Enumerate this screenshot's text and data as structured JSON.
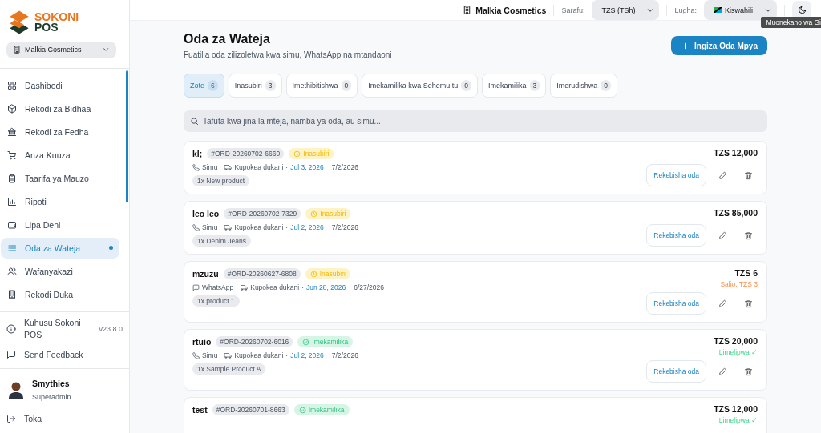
{
  "brand": {
    "line1": "SOKONI",
    "line2": "POS"
  },
  "store_selector": {
    "value": "Malkia Cosmetics"
  },
  "nav": [
    {
      "label": "Dashibodi",
      "selected": false
    },
    {
      "label": "Rekodi za Bidhaa",
      "selected": false
    },
    {
      "label": "Rekodi za Fedha",
      "selected": false
    },
    {
      "label": "Anza Kuuza",
      "selected": false
    },
    {
      "label": "Taarifa ya Mauzo",
      "selected": false
    },
    {
      "label": "Ripoti",
      "selected": false
    },
    {
      "label": "Lipa Deni",
      "selected": false
    },
    {
      "label": "Oda za Wateja",
      "selected": true
    },
    {
      "label": "Wafanyakazi",
      "selected": false
    },
    {
      "label": "Rekodi Duka",
      "selected": false
    }
  ],
  "about": {
    "label": "Kuhusu Sokoni POS",
    "version": "v23.8.0"
  },
  "feedback": {
    "label": "Send Feedback"
  },
  "user": {
    "name": "Smythies",
    "role": "Superadmin"
  },
  "logout": {
    "label": "Toka"
  },
  "topbar": {
    "store": "Malkia Cosmetics",
    "currency_label": "Sarafu:",
    "currency": "TZS (TSh)",
    "language_label": "Lugha:",
    "language": "Kiswahili",
    "tooltip": "Muonekano wa Gi"
  },
  "page": {
    "title": "Oda za Wateja",
    "subtitle": "Fuatilia oda zilizoletwa kwa simu, WhatsApp na mtandaoni",
    "new_button": "Ingiza Oda Mpya"
  },
  "filters": [
    {
      "label": "Zote",
      "count": "6",
      "selected": true
    },
    {
      "label": "Inasubiri",
      "count": "3",
      "selected": false
    },
    {
      "label": "Imethibitishwa",
      "count": "0",
      "selected": false
    },
    {
      "label": "Imekamilika kwa Sehemu tu",
      "count": "0",
      "selected": false
    },
    {
      "label": "Imekamilika",
      "count": "3",
      "selected": false
    },
    {
      "label": "Imerudishwa",
      "count": "0",
      "selected": false
    }
  ],
  "search": {
    "placeholder": "Tafuta kwa jina la mteja, namba ya oda, au simu..."
  },
  "orders": [
    {
      "customer": "kl;",
      "number": "#ORD-20260702-6660",
      "status": {
        "kind": "pending",
        "label": "Inasubiri"
      },
      "channel": {
        "kind": "phone",
        "label": "Simu"
      },
      "delivery": "Kupokea dukani",
      "separator": "·",
      "due": "Jul 3, 2026",
      "date": "7/2/2026",
      "items": [
        "1x New product"
      ],
      "total": "TZS 12,000",
      "action": "Rekebisha oda"
    },
    {
      "customer": "leo leo",
      "number": "#ORD-20260702-7329",
      "status": {
        "kind": "pending",
        "label": "Inasubiri"
      },
      "channel": {
        "kind": "phone",
        "label": "Simu"
      },
      "delivery": "Kupokea dukani",
      "separator": "·",
      "due": "Jul 2, 2026",
      "date": "7/2/2026",
      "items": [
        "1x Denim Jeans"
      ],
      "total": "TZS 85,000",
      "action": "Rekebisha oda"
    },
    {
      "customer": "mzuzu",
      "number": "#ORD-20260627-6808",
      "status": {
        "kind": "pending",
        "label": "Inasubiri"
      },
      "channel": {
        "kind": "whatsapp",
        "label": "WhatsApp"
      },
      "delivery": "Kupokea dukani",
      "separator": "·",
      "due": "Jun 28, 2026",
      "date": "6/27/2026",
      "items": [
        "1x product 1"
      ],
      "total": "TZS 6",
      "payment": {
        "kind": "balance",
        "label": "Salio: TZS 3"
      },
      "action": "Rekebisha oda"
    },
    {
      "customer": "rtuio",
      "number": "#ORD-20260702-6016",
      "status": {
        "kind": "completed",
        "label": "Imekamilika"
      },
      "channel": {
        "kind": "phone",
        "label": "Simu"
      },
      "delivery": "Kupokea dukani",
      "separator": "·",
      "due": "Jul 2, 2026",
      "date": "7/2/2026",
      "items": [
        "1x Sample Product A"
      ],
      "total": "TZS 20,000",
      "payment": {
        "kind": "paid",
        "label": "Limelipwa ✓"
      },
      "action": "Rekebisha oda"
    },
    {
      "customer": "test",
      "number": "#ORD-20260701-8663",
      "status": {
        "kind": "completed",
        "label": "Imekamilika"
      },
      "total": "TZS 12,000",
      "payment": {
        "kind": "paid",
        "label": "Limelipwa ✓"
      }
    }
  ]
}
